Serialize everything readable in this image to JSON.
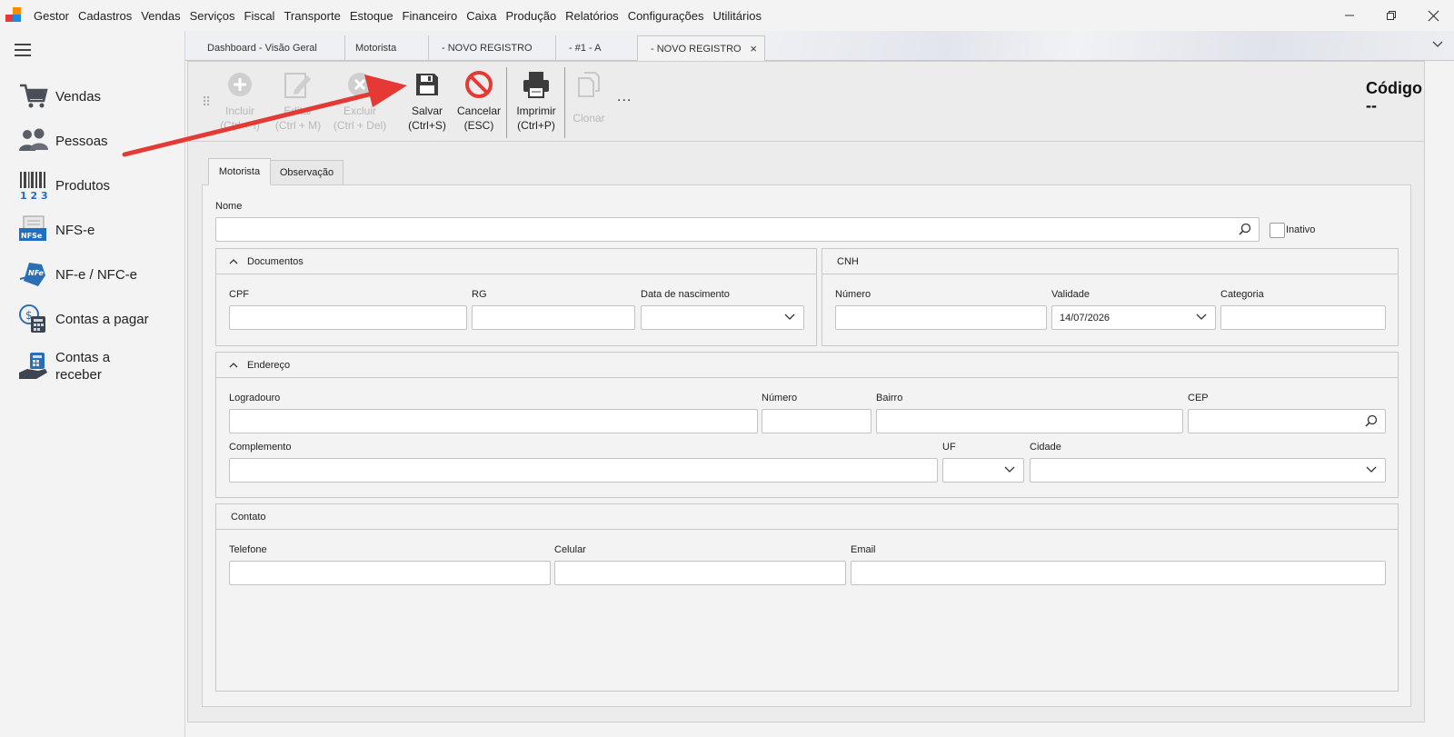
{
  "menubar": {
    "items": [
      "Gestor",
      "Cadastros",
      "Vendas",
      "Serviços",
      "Fiscal",
      "Transporte",
      "Estoque",
      "Financeiro",
      "Caixa",
      "Produção",
      "Relatórios",
      "Configurações",
      "Utilitários"
    ]
  },
  "sidebar": {
    "items": [
      {
        "label": "Vendas",
        "icon": "shopping-cart-icon"
      },
      {
        "label": "Pessoas",
        "icon": "people-icon"
      },
      {
        "label": "Produtos",
        "icon": "barcode-icon"
      },
      {
        "label": "NFS-e",
        "icon": "nfse-icon"
      },
      {
        "label": "NF-e / NFC-e",
        "icon": "nfe-icon"
      },
      {
        "label": "Contas a pagar",
        "icon": "calculator-icon"
      },
      {
        "label": "Contas a\nreceber",
        "icon": "money-hand-icon"
      }
    ]
  },
  "tabs": [
    {
      "label": "Dashboard - Visão Geral"
    },
    {
      "label": "Motorista"
    },
    {
      "label": "- NOVO REGISTRO"
    },
    {
      "label": "- #1 - A"
    },
    {
      "label": "- NOVO REGISTRO",
      "active": true
    }
  ],
  "toolbar": {
    "incluir": {
      "line1": "Incluir",
      "line2": "(Ctrl + I)"
    },
    "editar": {
      "line1": "Editar",
      "line2": "(Ctrl + M)"
    },
    "excluir": {
      "line1": "Excluir",
      "line2": "(Ctrl + Del)"
    },
    "salvar": {
      "line1": "Salvar",
      "line2": "(Ctrl+S)"
    },
    "cancelar": {
      "line1": "Cancelar",
      "line2": "(ESC)"
    },
    "imprimir": {
      "line1": "Imprimir",
      "line2": "(Ctrl+P)"
    },
    "clonar": {
      "line1": "Clonar"
    },
    "more": "..."
  },
  "codigo": {
    "label": "Código",
    "value": "--"
  },
  "form_tabs": [
    "Motorista",
    "Observação"
  ],
  "form": {
    "nome_label": "Nome",
    "inativo_label": "Inativo",
    "documentos": {
      "title": "Documentos",
      "cpf": "CPF",
      "rg": "RG",
      "nascimento": "Data de nascimento"
    },
    "cnh": {
      "title": "CNH",
      "numero": "Número",
      "validade": "Validade",
      "validade_value": "14/07/2026",
      "categoria": "Categoria"
    },
    "endereco": {
      "title": "Endereço",
      "logradouro": "Logradouro",
      "numero": "Número",
      "bairro": "Bairro",
      "cep": "CEP",
      "complemento": "Complemento",
      "uf": "UF",
      "cidade": "Cidade"
    },
    "contato": {
      "title": "Contato",
      "telefone": "Telefone",
      "celular": "Celular",
      "email": "Email"
    }
  },
  "colors": {
    "annotation_arrow": "#e53935",
    "cancel_red": "#e53935"
  }
}
